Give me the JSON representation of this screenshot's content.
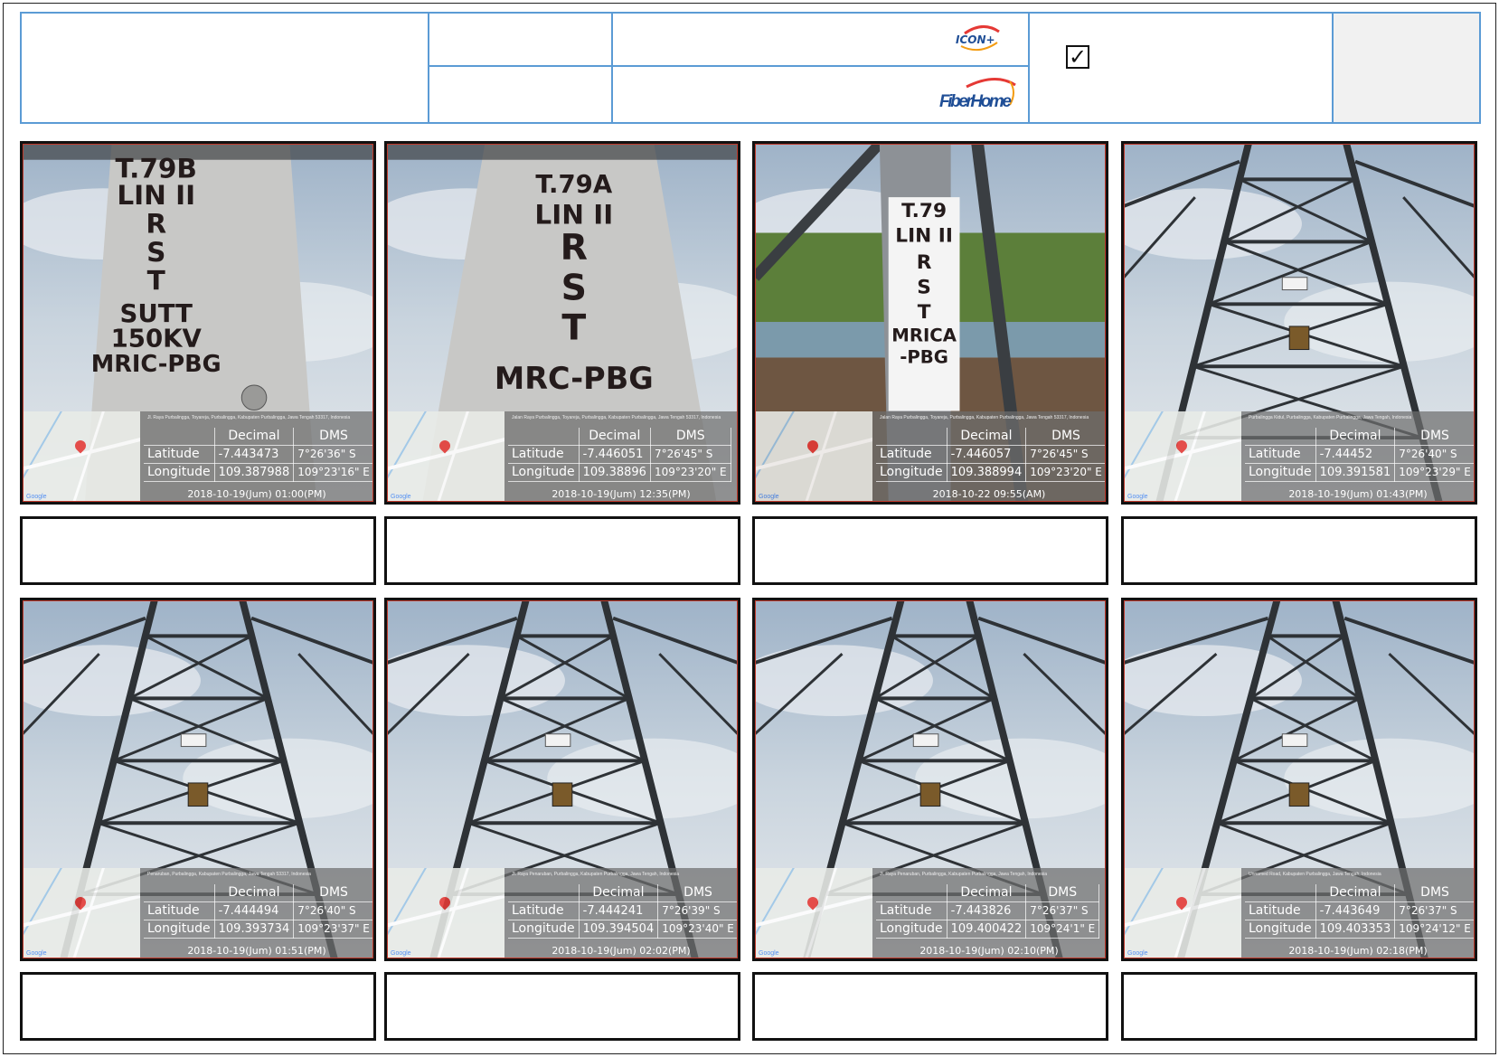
{
  "header": {
    "checkbox_mark": "✓",
    "logos": [
      "ICON+",
      "FiberHome"
    ]
  },
  "photos": [
    {
      "tower_text": [
        "T.79B",
        "LIN II",
        "R",
        "S",
        "T",
        "SUTT",
        "150KV",
        "MRIC-PBG"
      ],
      "addr": "Jl. Raya Purbalingga, Toyareja, Purbalingga, Kabupaten Purbalingga, Jawa Tengah 53317, Indonesia",
      "table": {
        "h_decimal": "Decimal",
        "h_dms": "DMS",
        "lat_label": "Latitude",
        "lon_label": "Longitude",
        "lat_dec": "-7.443473",
        "lat_dms": "7°26'36\" S",
        "lon_dec": "109.387988",
        "lon_dms": "109°23'16\" E"
      },
      "timestamp": "2018-10-19(Jum)  01:00(PM)"
    },
    {
      "tower_text": [
        "T.79A",
        "LIN II",
        "R",
        "S",
        "T",
        "MRC-PBG"
      ],
      "addr": "Jalan Raya Purbalingga, Toyareja, Purbalingga, Kabupaten Purbalingga, Jawa Tengah 53317, Indonesia",
      "table": {
        "h_decimal": "Decimal",
        "h_dms": "DMS",
        "lat_label": "Latitude",
        "lon_label": "Longitude",
        "lat_dec": "-7.446051",
        "lat_dms": "7°26'45\" S",
        "lon_dec": "109.38896",
        "lon_dms": "109°23'20\" E"
      },
      "timestamp": "2018-10-19(Jum)  12:35(PM)"
    },
    {
      "tower_text": [
        "T.79",
        "LIN II",
        "R",
        "S",
        "T",
        "MRICA",
        "-PBG"
      ],
      "addr": "Jalan Raya Purbalingga, Toyareja, Purbalingga, Kabupaten Purbalingga, Jawa Tengah 53317, Indonesia",
      "table": {
        "h_decimal": "Decimal",
        "h_dms": "DMS",
        "lat_label": "Latitude",
        "lon_label": "Longitude",
        "lat_dec": "-7.446057",
        "lat_dms": "7°26'45\" S",
        "lon_dec": "109.388994",
        "lon_dms": "109°23'20\" E"
      },
      "timestamp": "2018-10-22  09:55(AM)"
    },
    {
      "tower_text": [],
      "addr": "Purbalingga Kidul, Purbalingga, Kabupaten Purbalingga, Jawa Tengah, Indonesia",
      "table": {
        "h_decimal": "Decimal",
        "h_dms": "DMS",
        "lat_label": "Latitude",
        "lon_label": "Longitude",
        "lat_dec": "-7.44452",
        "lat_dms": "7°26'40\" S",
        "lon_dec": "109.391581",
        "lon_dms": "109°23'29\" E"
      },
      "timestamp": "2018-10-19(Jum)  01:43(PM)"
    },
    {
      "tower_text": [],
      "addr": "Penaruban, Purbalingga, Kabupaten Purbalingga, Jawa Tengah 53317, Indonesia",
      "table": {
        "h_decimal": "Decimal",
        "h_dms": "DMS",
        "lat_label": "Latitude",
        "lon_label": "Longitude",
        "lat_dec": "-7.444494",
        "lat_dms": "7°26'40\" S",
        "lon_dec": "109.393734",
        "lon_dms": "109°23'37\" E"
      },
      "timestamp": "2018-10-19(Jum)  01:51(PM)"
    },
    {
      "tower_text": [],
      "addr": "Jl. Raya Penaruban, Purbalingga, Kabupaten Purbalingga, Jawa Tengah, Indonesia",
      "table": {
        "h_decimal": "Decimal",
        "h_dms": "DMS",
        "lat_label": "Latitude",
        "lon_label": "Longitude",
        "lat_dec": "-7.444241",
        "lat_dms": "7°26'39\" S",
        "lon_dec": "109.394504",
        "lon_dms": "109°23'40\" E"
      },
      "timestamp": "2018-10-19(Jum)  02:02(PM)"
    },
    {
      "tower_text": [],
      "addr": "Jl. Raya Penaruban, Purbalingga, Kabupaten Purbalingga, Jawa Tengah, Indonesia",
      "table": {
        "h_decimal": "Decimal",
        "h_dms": "DMS",
        "lat_label": "Latitude",
        "lon_label": "Longitude",
        "lat_dec": "-7.443826",
        "lat_dms": "7°26'37\" S",
        "lon_dec": "109.400422",
        "lon_dms": "109°24'1\" E"
      },
      "timestamp": "2018-10-19(Jum)  02:10(PM)"
    },
    {
      "tower_text": [],
      "addr": "Unnamed Road, Kabupaten Purbalingga, Jawa Tengah, Indonesia",
      "table": {
        "h_decimal": "Decimal",
        "h_dms": "DMS",
        "lat_label": "Latitude",
        "lon_label": "Longitude",
        "lat_dec": "-7.443649",
        "lat_dms": "7°26'37\" S",
        "lon_dec": "109.403353",
        "lon_dms": "109°24'12\" E"
      },
      "timestamp": "2018-10-19(Jum)  02:18(PM)"
    }
  ],
  "captions": [
    "",
    "",
    "",
    "",
    "",
    "",
    "",
    ""
  ]
}
